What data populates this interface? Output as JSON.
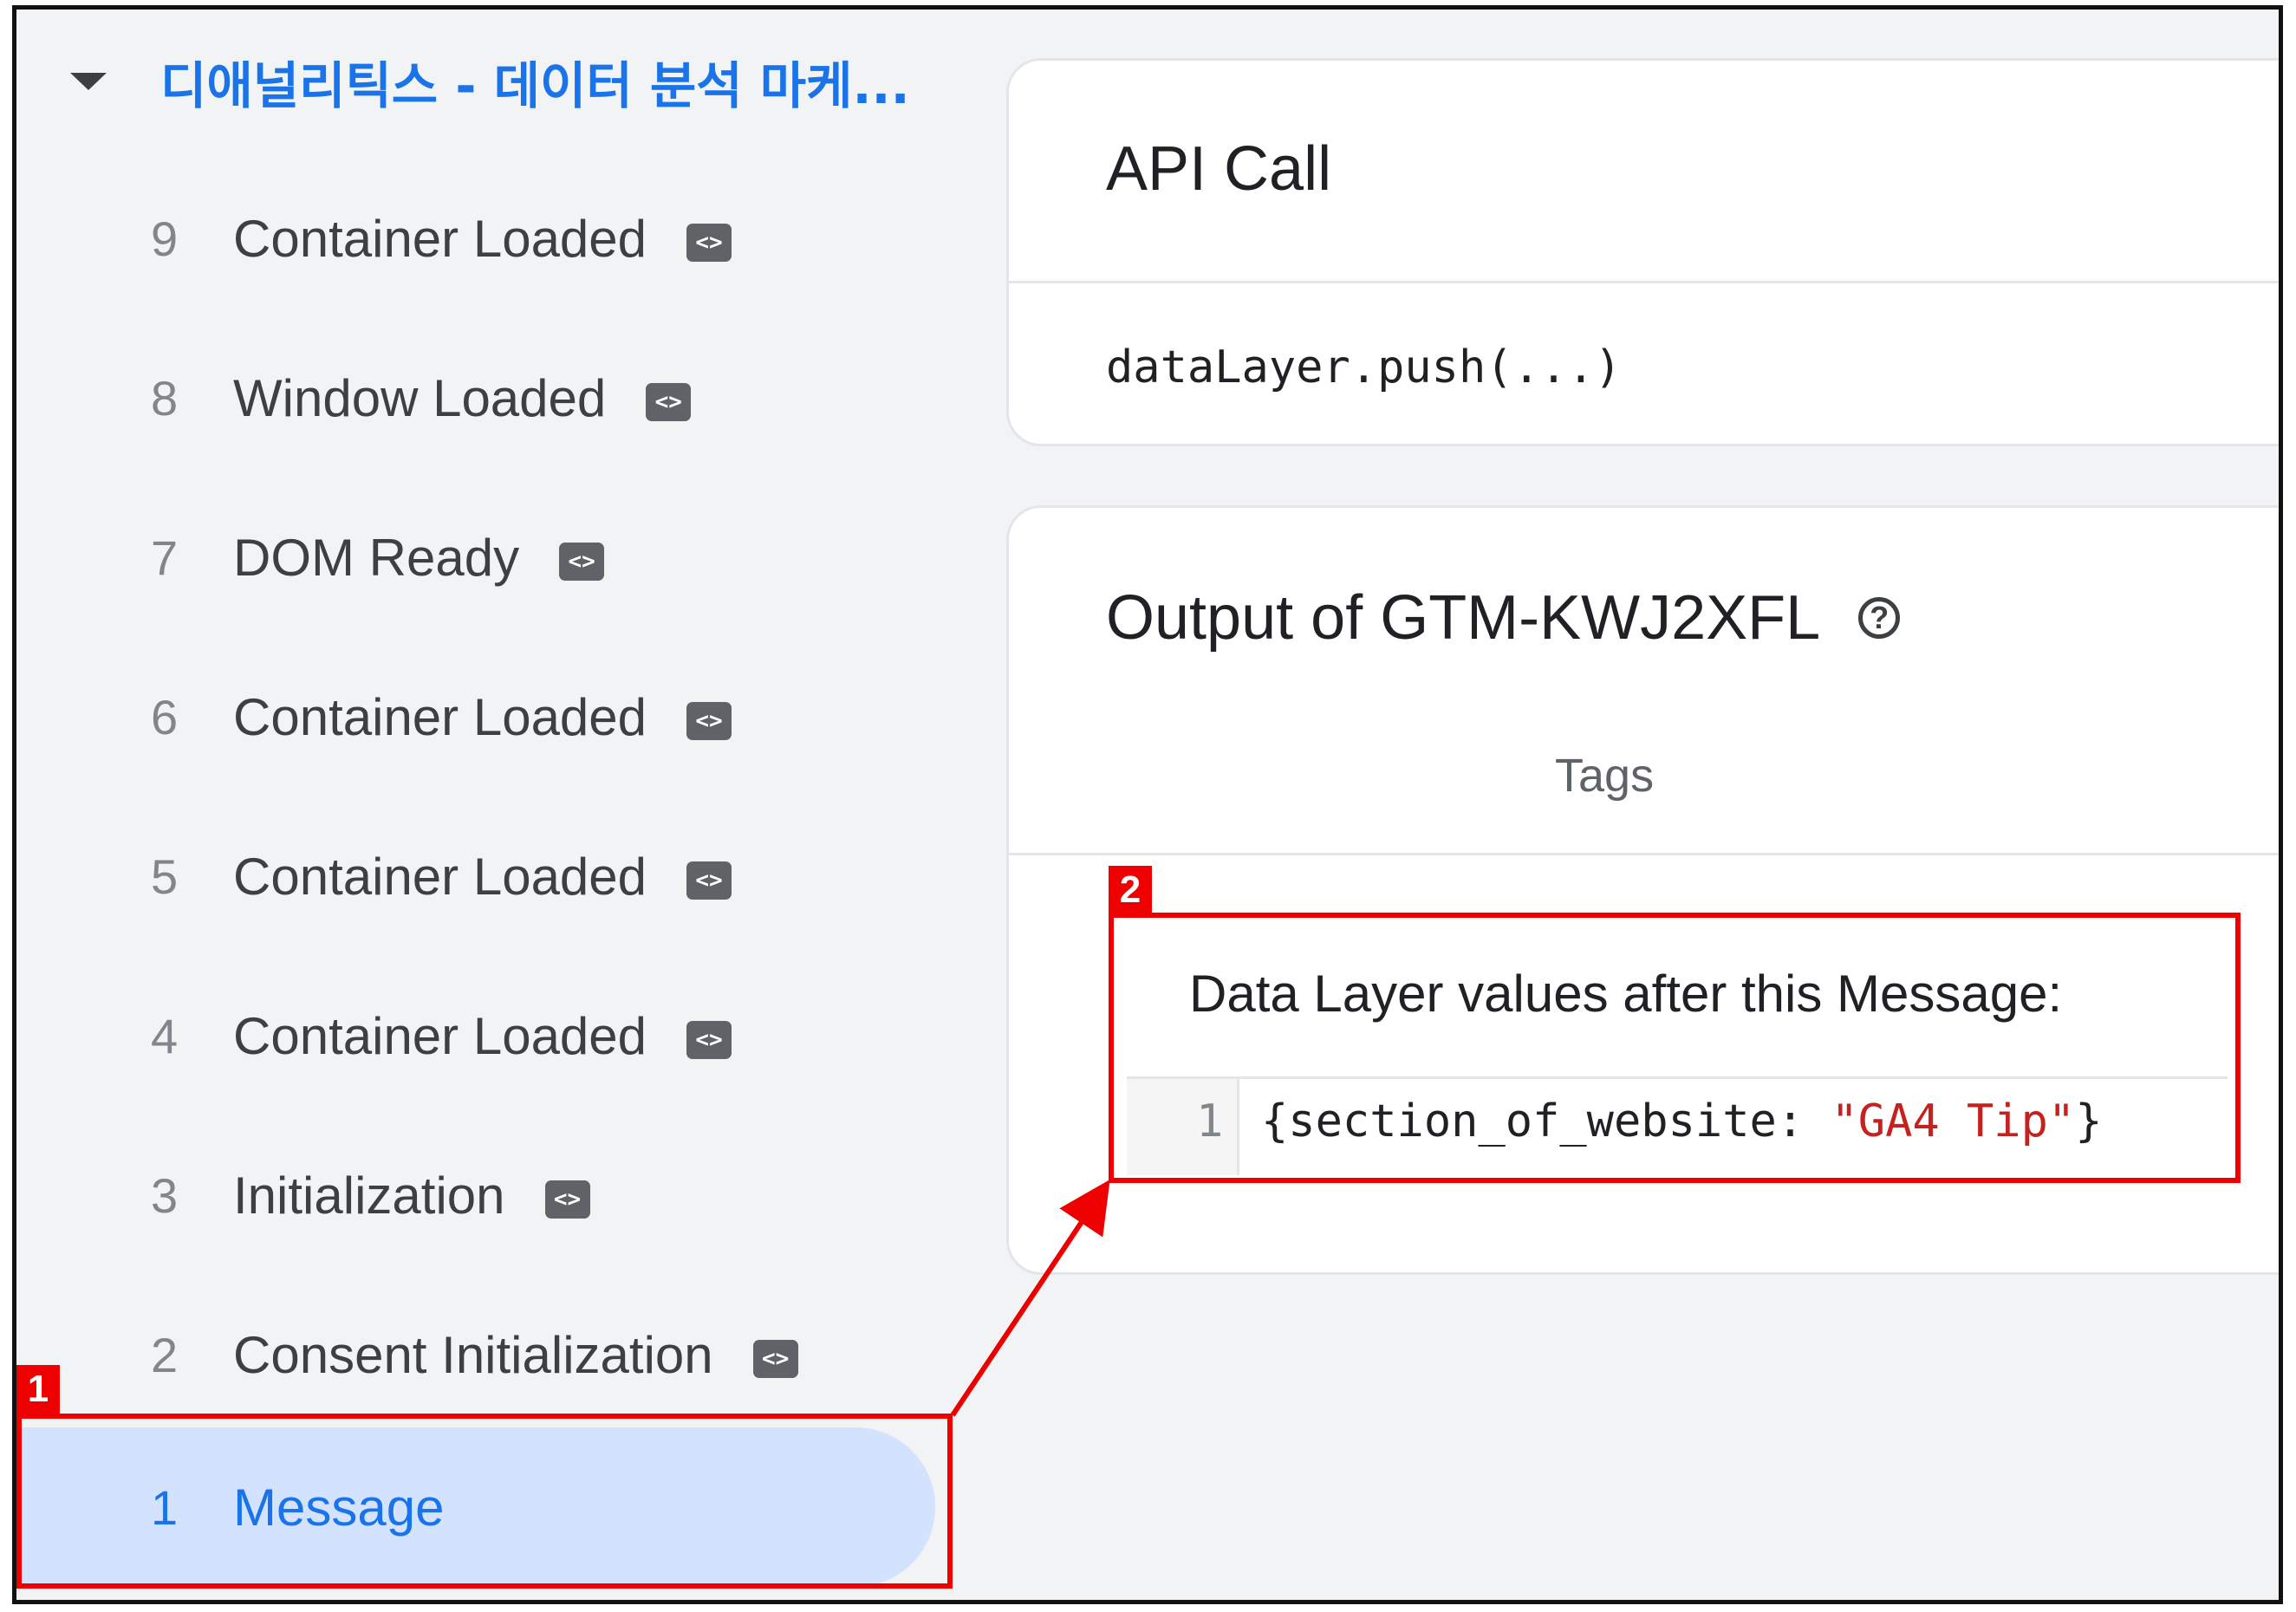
{
  "sidebar": {
    "container_title": "디애널리틱스 - 데이터 분석 마케...",
    "tag_icon_glyph": "<>",
    "events": [
      {
        "num": "9",
        "label": "Container Loaded",
        "has_icon": true
      },
      {
        "num": "8",
        "label": "Window Loaded",
        "has_icon": true
      },
      {
        "num": "7",
        "label": "DOM Ready",
        "has_icon": true
      },
      {
        "num": "6",
        "label": "Container Loaded",
        "has_icon": true
      },
      {
        "num": "5",
        "label": "Container Loaded",
        "has_icon": true
      },
      {
        "num": "4",
        "label": "Container Loaded",
        "has_icon": true
      },
      {
        "num": "3",
        "label": "Initialization",
        "has_icon": true
      },
      {
        "num": "2",
        "label": "Consent Initialization",
        "has_icon": true
      },
      {
        "num": "1",
        "label": "Message",
        "has_icon": false,
        "selected": true
      }
    ]
  },
  "api_card": {
    "title": "API Call",
    "code": "dataLayer.push(...)"
  },
  "output_card": {
    "title": "Output of GTM-KWJ2XFL",
    "help_glyph": "?",
    "tab_label": "Tags",
    "data_layer": {
      "title": "Data Layer values after this Message:",
      "line_number": "1",
      "code_prefix": "{section_of_website: ",
      "code_string": "\"GA4 Tip\"",
      "code_suffix": "}"
    }
  },
  "annotations": {
    "badge_1": "1",
    "badge_2": "2",
    "color": "#ee0000"
  }
}
